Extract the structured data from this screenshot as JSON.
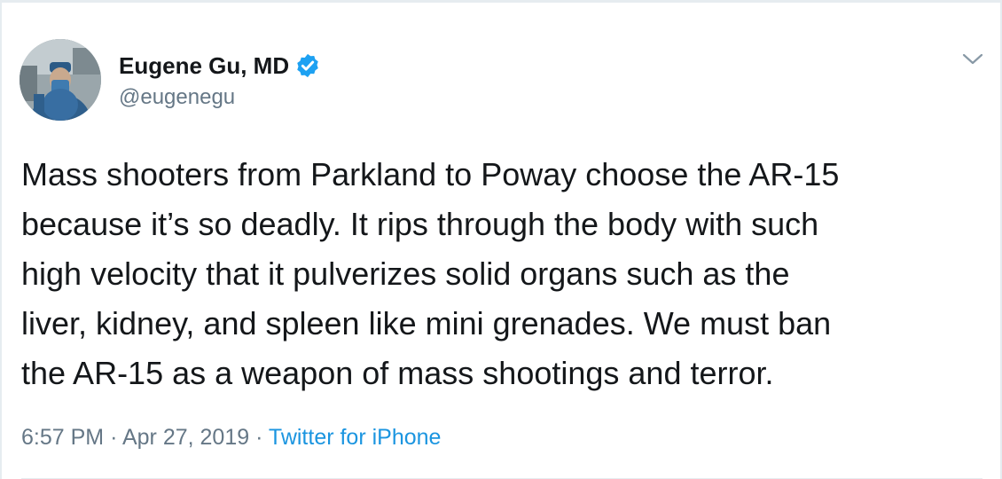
{
  "tweet": {
    "author": {
      "display_name": "Eugene Gu, MD",
      "handle": "@eugenegu",
      "verified": true
    },
    "text": "Mass shooters from Parkland to Poway choose the AR-15\nbecause it’s so deadly. It rips through the body with such\nhigh velocity that it pulverizes solid organs such as the\nliver, kidney, and spleen like mini grenades. We must ban\nthe AR-15 as a weapon of mass shootings and terror.",
    "time": "6:57 PM",
    "separator": "·",
    "date": "Apr 27, 2019",
    "source": "Twitter for iPhone"
  },
  "icons": {
    "verified": "verified-badge-icon",
    "menu": "chevron-down-icon",
    "avatar": "profile-avatar"
  },
  "colors": {
    "text": "#14171a",
    "secondary": "#657786",
    "link": "#1b95e0",
    "verified": "#1da1f2",
    "border": "#e6ecf0"
  }
}
